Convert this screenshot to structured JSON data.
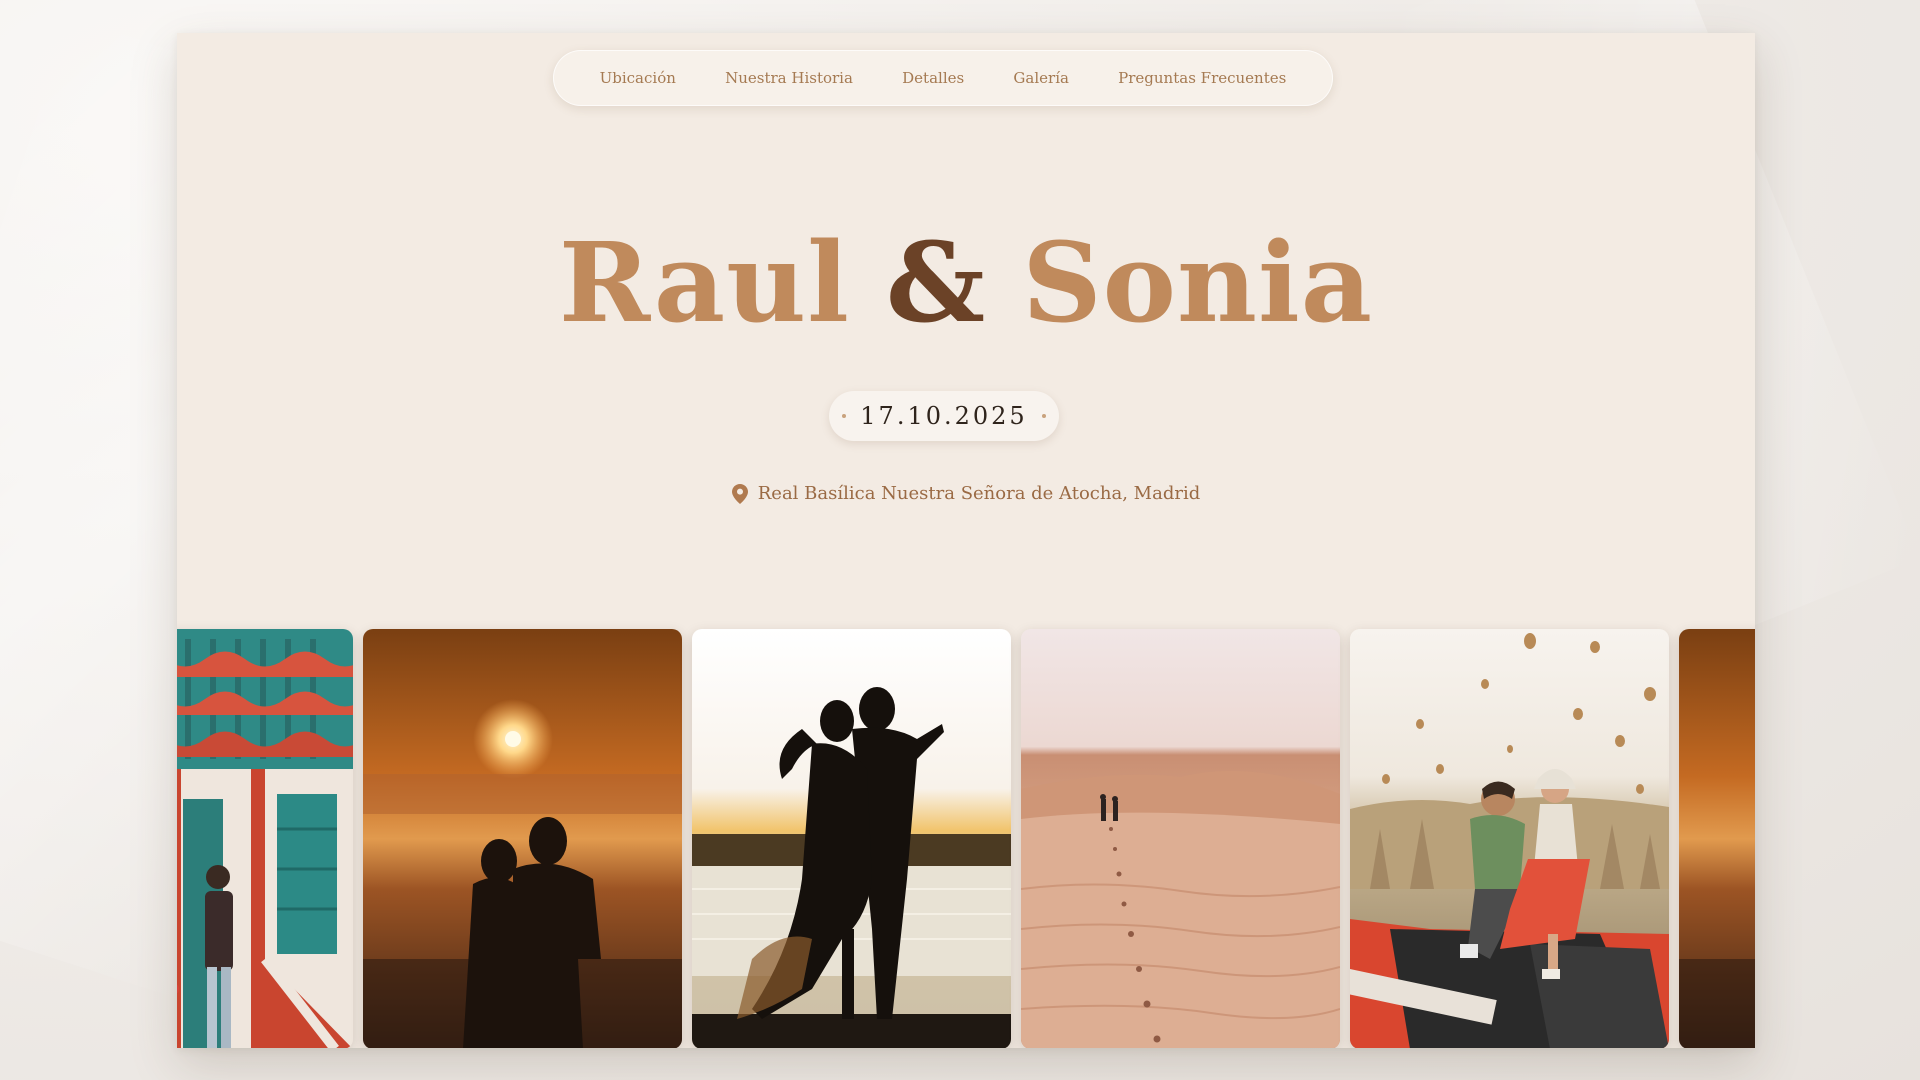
{
  "nav": {
    "items": [
      {
        "label": "Ubicación"
      },
      {
        "label": "Nuestra Historia"
      },
      {
        "label": "Detalles"
      },
      {
        "label": "Galería"
      },
      {
        "label": "Preguntas Frecuentes"
      }
    ]
  },
  "hero": {
    "name_1": "Raul",
    "ampersand": "&",
    "name_2": "Sonia",
    "date": "17.10.2025",
    "location": "Real Basílica Nuestra Señora de Atocha, Madrid",
    "location_icon": "map-pin-icon"
  },
  "colors": {
    "page_background": "#f3ebe3",
    "name_color": "#c08a5c",
    "ampersand_color": "#6b4227",
    "nav_text": "#a57a52",
    "date_text": "#2f241c"
  },
  "gallery": {
    "photos": [
      "couple-by-colorful-house",
      "couple-silhouette-at-sunset",
      "couple-kissing-at-sunset-lake",
      "couple-walking-in-desert",
      "couple-in-red-convertible-with-balloons",
      "sunset-photo-partial"
    ]
  }
}
